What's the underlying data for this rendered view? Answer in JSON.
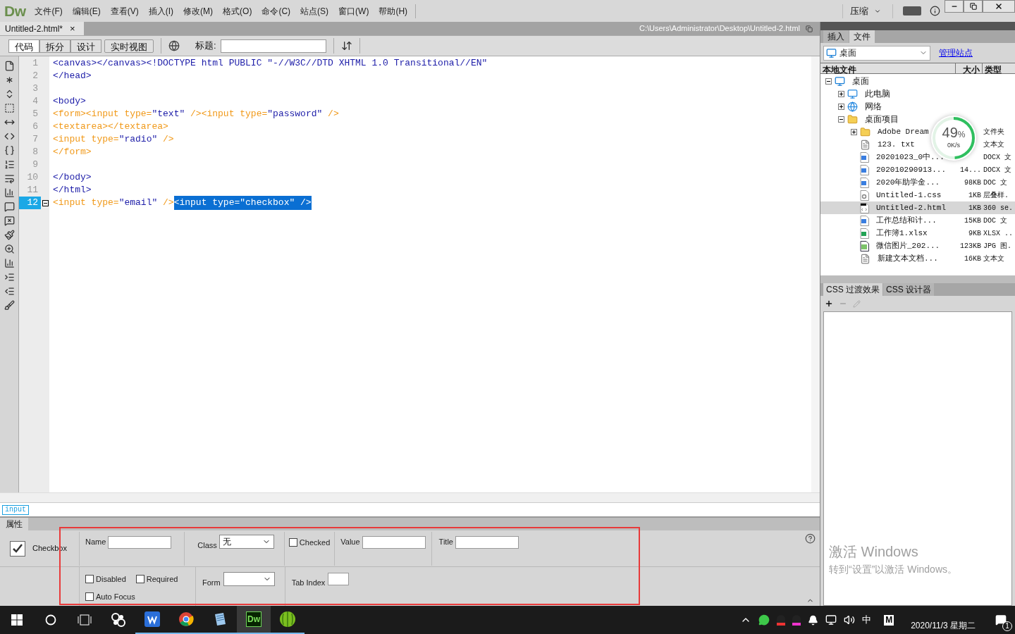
{
  "app": {
    "logo": "Dw",
    "menu": [
      "文件(F)",
      "编辑(E)",
      "查看(V)",
      "插入(I)",
      "修改(M)",
      "格式(O)",
      "命令(C)",
      "站点(S)",
      "窗口(W)",
      "帮助(H)"
    ],
    "workspace": "压缩"
  },
  "document": {
    "tab": "Untitled-2.html*",
    "close": "×",
    "path": "C:\\Users\\Administrator\\Desktop\\Untitled-2.html"
  },
  "view_buttons": [
    {
      "label": "代码",
      "selected": true
    },
    {
      "label": "拆分",
      "selected": false
    },
    {
      "label": "设计",
      "selected": false
    },
    {
      "label": "实时视图",
      "selected": false
    }
  ],
  "title_field": {
    "label": "标题:"
  },
  "code": [
    {
      "number": "1",
      "active": false,
      "tokens": [
        {
          "kind": "tag",
          "text": "<canvas></canvas><!DOCTYPE html PUBLIC \"-//W3C//DTD XHTML 1.0 Transitional//EN\""
        }
      ]
    },
    {
      "number": "2",
      "active": false,
      "tokens": [
        {
          "kind": "tag",
          "text": "</head>"
        }
      ]
    },
    {
      "number": "3",
      "active": false
    },
    {
      "number": "4",
      "active": false,
      "tokens": [
        {
          "kind": "tag",
          "text": "<body>"
        }
      ]
    },
    {
      "number": "5",
      "active": false,
      "tokens": [
        {
          "kind": "form",
          "text": "<form><input type="
        },
        {
          "kind": "value",
          "text": "\"text\""
        },
        {
          "kind": "form",
          "text": " /><input type="
        },
        {
          "kind": "value",
          "text": "\"password\""
        },
        {
          "kind": "form",
          "text": " />"
        }
      ]
    },
    {
      "number": "6",
      "active": false,
      "tokens": [
        {
          "kind": "form",
          "text": "<textarea></textarea>"
        }
      ]
    },
    {
      "number": "7",
      "active": false,
      "tokens": [
        {
          "kind": "form",
          "text": "<input type="
        },
        {
          "kind": "value",
          "text": "\"radio\""
        },
        {
          "kind": "form",
          "text": " />"
        }
      ]
    },
    {
      "number": "8",
      "active": false,
      "tokens": [
        {
          "kind": "form",
          "text": "</form>"
        }
      ]
    },
    {
      "number": "9",
      "active": false
    },
    {
      "number": "10",
      "active": false,
      "tokens": [
        {
          "kind": "tag",
          "text": "</body>"
        }
      ]
    },
    {
      "number": "11",
      "active": false,
      "tokens": [
        {
          "kind": "tag",
          "text": "</html>"
        }
      ]
    },
    {
      "number": "12",
      "active": true,
      "tokens": [
        {
          "kind": "form",
          "text": "<input type="
        },
        {
          "kind": "value",
          "text": "\"email\""
        },
        {
          "kind": "form",
          "text": " />"
        },
        {
          "kind": "selection",
          "text": "<input type=\"checkbox\" />"
        }
      ]
    }
  ],
  "tag_selector": "input",
  "properties": {
    "tab": "属性",
    "element": "Checkbox",
    "name": {
      "label": "Name"
    },
    "class": {
      "label": "Class",
      "value": "无"
    },
    "checked": {
      "label": "Checked",
      "checked": false
    },
    "value": {
      "label": "Value"
    },
    "title": {
      "label": "Title"
    },
    "disabled": {
      "label": "Disabled",
      "checked": false
    },
    "required": {
      "label": "Required",
      "checked": false
    },
    "auto_focus": {
      "label": "Auto Focus",
      "checked": false
    },
    "form": {
      "label": "Form"
    },
    "tab_index": {
      "label": "Tab Index"
    }
  },
  "files_panel": {
    "tabs": [
      {
        "label": "插入",
        "selected": false
      },
      {
        "label": "文件",
        "selected": true
      }
    ],
    "location": "桌面",
    "manage_link": "管理站点",
    "columns": [
      "本地文件",
      "大小",
      "类型"
    ],
    "tree": [
      {
        "name": "桌面",
        "kind": "desktop",
        "expanded": true,
        "selected": false,
        "children": [
          {
            "name": "此电脑",
            "kind": "computer",
            "expanded": false,
            "selected": false
          },
          {
            "name": "网络",
            "kind": "network",
            "expanded": false,
            "selected": false
          },
          {
            "name": "桌面项目",
            "kind": "folder",
            "expanded": true,
            "selected": false,
            "children": [
              {
                "name": "Adobe Dream",
                "type": "文件夹",
                "kind": "folder",
                "expanded": false,
                "selected": false
              },
              {
                "name": "123. txt",
                "type": "文本文",
                "kind": "text",
                "selected": false
              },
              {
                "name": "20201023_0中...",
                "type": "DOCX 文",
                "kind": "word",
                "selected": false
              },
              {
                "name": "202010290913...",
                "size": "14...",
                "type": "DOCX 文",
                "kind": "word",
                "selected": false
              },
              {
                "name": "2020年助学金...",
                "size": "98KB",
                "type": "DOC 文",
                "kind": "word",
                "selected": false
              },
              {
                "name": "Untitled-1.css",
                "size": "1KB",
                "type": "层叠样.",
                "kind": "css",
                "selected": false
              },
              {
                "name": "Untitled-2.html",
                "size": "1KB",
                "type": "360 se.",
                "kind": "html",
                "selected": true
              },
              {
                "name": "工作总结和计...",
                "size": "15KB",
                "type": "DOC 文",
                "kind": "word",
                "selected": false
              },
              {
                "name": "工作簿1.xlsx",
                "size": "9KB",
                "type": "XLSX ..",
                "kind": "sheet",
                "selected": false
              },
              {
                "name": "微信图片_202...",
                "size": "123KB",
                "type": "JPG 图.",
                "kind": "image",
                "selected": false
              },
              {
                "name": "新建文本文档...",
                "size": "16KB",
                "type": "文本文",
                "kind": "text",
                "selected": false
              }
            ]
          }
        ]
      }
    ]
  },
  "css_panel": {
    "tabs": [
      {
        "label": "CSS 过渡效果",
        "selected": true
      },
      {
        "label": "CSS 设计器",
        "selected": false
      }
    ]
  },
  "speed_widget": {
    "percent": "49",
    "unit": "%",
    "speed": "0K/s",
    "level": 0.49
  },
  "activation": {
    "title": "激活 Windows",
    "subtitle": "转到“设置”以激活 Windows。"
  },
  "taskbar": {
    "apps": [
      {
        "kind": "wps",
        "active": false
      },
      {
        "kind": "chrome",
        "active": false
      },
      {
        "kind": "notepad",
        "active": false
      },
      {
        "kind": "dreamweaver",
        "label": "Dw",
        "active": true
      },
      {
        "kind": "melon",
        "active": false
      }
    ],
    "ime": "中",
    "ime_mode": "M",
    "date": "2020/11/3 星期二",
    "notifications": "1"
  }
}
